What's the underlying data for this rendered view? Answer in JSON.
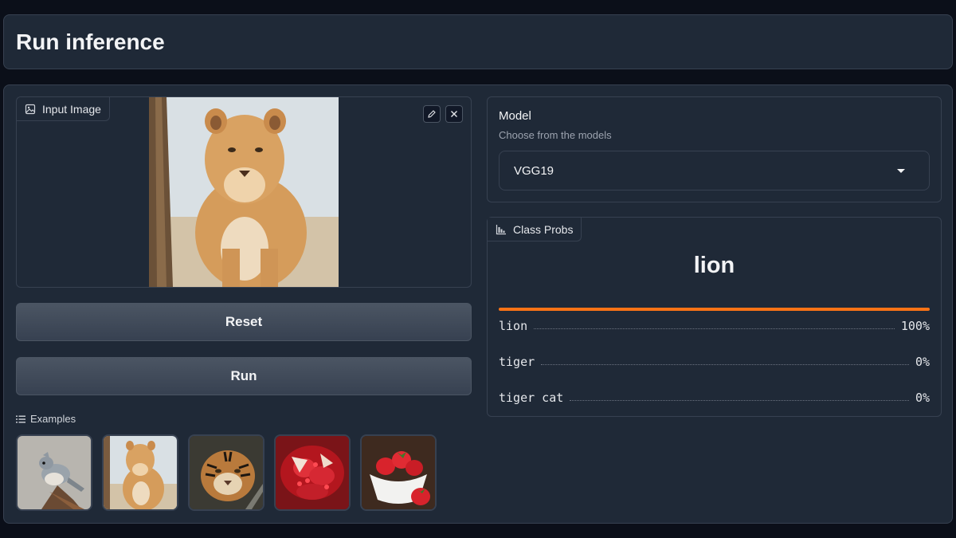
{
  "header": {
    "title": "Run inference"
  },
  "input_image": {
    "label": "Input Image",
    "edit_icon": "pencil-icon",
    "clear_icon": "close-icon"
  },
  "buttons": {
    "reset": "Reset",
    "run": "Run"
  },
  "examples": {
    "label": "Examples",
    "items": [
      "bird",
      "lion",
      "tiger",
      "pomegranate",
      "strawberries"
    ]
  },
  "model": {
    "label": "Model",
    "info": "Choose from the models",
    "selected": "VGG19"
  },
  "class_probs": {
    "label": "Class Probs",
    "top_label": "lion",
    "top_confidence": 1.0,
    "rows": [
      {
        "label": "lion",
        "value": "100%"
      },
      {
        "label": "tiger",
        "value": "0%"
      },
      {
        "label": "tiger cat",
        "value": "0%"
      }
    ]
  },
  "colors": {
    "accent": "#f97316",
    "panel": "#1f2937",
    "border": "#374151"
  }
}
